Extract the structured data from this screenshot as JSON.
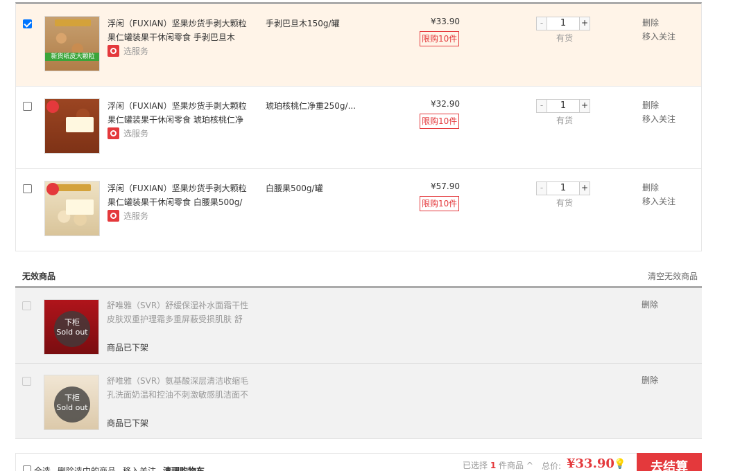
{
  "cart": {
    "items": [
      {
        "checked": true,
        "title": "浮闲（FUXIAN）坚果炒货手剥大颗粒果仁罐装果干休闲零食 手剥巴旦木",
        "service": "选服务",
        "spec": "手剥巴旦木150g/罐",
        "price": "¥33.90",
        "limit": "限购10件",
        "qty": "1",
        "stock": "有货",
        "delete": "删除",
        "follow": "移入关注",
        "band": "新货纸皮大颗粒"
      },
      {
        "checked": false,
        "title": "浮闲（FUXIAN）坚果炒货手剥大颗粒果仁罐装果干休闲零食 琥珀核桃仁净",
        "service": "选服务",
        "spec": "琥珀核桃仁净重250g/...",
        "price": "¥32.90",
        "limit": "限购10件",
        "qty": "1",
        "stock": "有货",
        "delete": "删除",
        "follow": "移入关注",
        "band": ""
      },
      {
        "checked": false,
        "title": "浮闲（FUXIAN）坚果炒货手剥大颗粒果仁罐装果干休闲零食 白腰果500g/",
        "service": "选服务",
        "spec": "白腰果500g/罐",
        "price": "¥57.90",
        "limit": "限购10件",
        "qty": "1",
        "stock": "有货",
        "delete": "删除",
        "follow": "移入关注",
        "band": ""
      }
    ],
    "qty_minus": "-",
    "qty_plus": "+"
  },
  "invalid": {
    "heading": "无效商品",
    "clear_label": "清空无效商品",
    "items": [
      {
        "title": "舒唯雅（SVR）舒缓保湿补水面霜干性皮肤双重护理霜多重屏蔽受损肌肤 舒",
        "status": "商品已下架",
        "soldout_cn": "下柜",
        "soldout_en": "Sold out",
        "delete": "删除"
      },
      {
        "title": "舒唯雅（SVR）氨基酸深层清洁收缩毛孔洗面奶温和控油不刺激敏感肌洁面不",
        "status": "商品已下架",
        "soldout_cn": "下柜",
        "soldout_en": "Sold out",
        "delete": "删除"
      }
    ]
  },
  "footer": {
    "select_all": "全选",
    "delete_selected": "删除选中的商品",
    "move_follow": "移入关注",
    "clean_cart": "清理购物车",
    "selected_prefix": "已选择",
    "selected_count": "1",
    "selected_suffix": "件商品 ^",
    "total_label": "总价:",
    "total": "¥33.90",
    "checkout": "去结算"
  },
  "colors": {
    "accent": "#e4393c",
    "selected_bg": "#fff4e8",
    "invalid_bg": "#f2f2f2"
  }
}
